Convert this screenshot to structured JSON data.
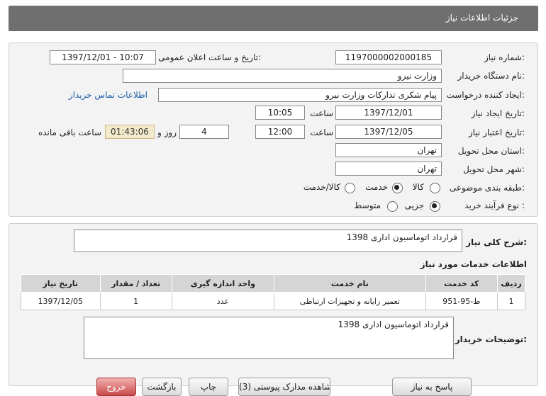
{
  "title": "جزئیات اطلاعات نیاز",
  "form": {
    "need_number_label": "شماره نیاز:",
    "need_number": "1197000002000185",
    "announce_label": "تاریخ و ساعت اعلان عمومی:",
    "announce_value": "1397/12/01 - 10:07",
    "buyer_org_label": "نام دستگاه خریدار:",
    "buyer_org": "وزارت نیرو",
    "creator_label": "ایجاد کننده درخواست:",
    "creator": "پیام شکری تدارکات وزارت نیرو",
    "contact_link": "اطلاعات تماس خریدار",
    "created_date_label": "تاریخ ایجاد نیاز:",
    "created_date": "1397/12/01",
    "time_label": "ساعت",
    "created_time": "10:05",
    "validity_label": "تاریخ اعتبار نیاز:",
    "validity_date": "1397/12/05",
    "validity_time": "12:00",
    "days": "4",
    "days_label": "روز و",
    "remaining": "01:43:06",
    "remaining_label": "ساعت باقی مانده",
    "province_label": "استان محل تحویل:",
    "province": "تهران",
    "city_label": "شهر محل تحویل:",
    "city": "تهران",
    "category_label": "طبقه بندی موضوعی:",
    "category_options": [
      "کالا",
      "خدمت",
      "کالا/خدمت"
    ],
    "category_selected": "خدمت",
    "process_label": "نوع فرآیند خرید :",
    "process_options": [
      "جزیی",
      "متوسط"
    ],
    "process_selected": "جزیی"
  },
  "summary": {
    "label": "شرح کلی نیاز:",
    "value": "قرارداد اتوماسیون اداری 1398"
  },
  "services": {
    "title": "اطلاعات خدمات مورد نیاز",
    "headers": [
      "ردیف",
      "کد خدمت",
      "نام خدمت",
      "واحد اندازه گیری",
      "تعداد / مقدار",
      "تاریخ نیاز"
    ],
    "rows": [
      [
        "1",
        "ط-95-951",
        "تعمیر رایانه و تجهیزات ارتباطی",
        "عدد",
        "1",
        "1397/12/05"
      ]
    ]
  },
  "buyer_notes": {
    "label": "توضیحات خریدار:",
    "value": "قرارداد اتوماسیون اداری 1398"
  },
  "buttons": {
    "reply": "پاسخ به نیاز",
    "view_docs": "مشاهده مدارک پیوستی (3)",
    "print": "چاپ",
    "back": "بازگشت",
    "exit": "خروج"
  }
}
